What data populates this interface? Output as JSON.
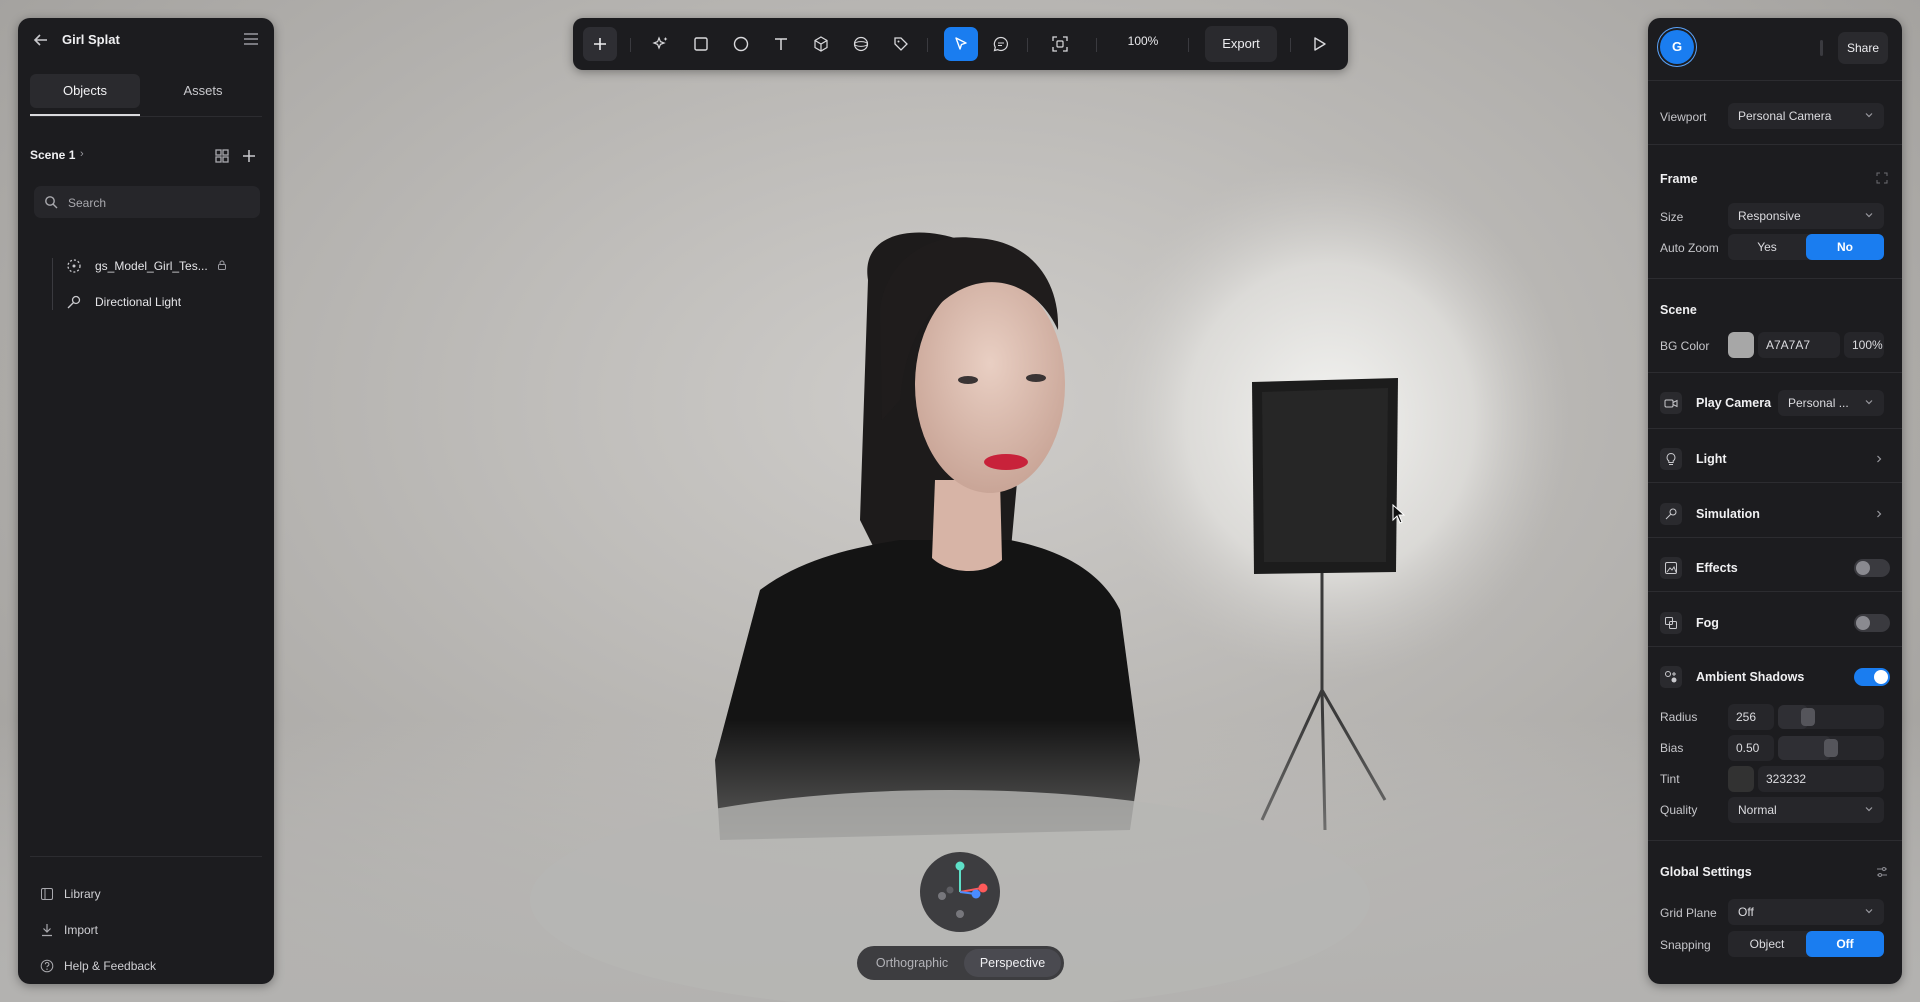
{
  "left_panel": {
    "title": "Girl Splat",
    "tabs": [
      {
        "label": "Objects",
        "active": true
      },
      {
        "label": "Assets",
        "active": false
      }
    ],
    "scene": {
      "label": "Scene 1"
    },
    "search": {
      "placeholder": "Search"
    },
    "tree": [
      {
        "label": "gs_Model_Girl_Tes...",
        "icon": "splat-icon",
        "locked": true
      },
      {
        "label": "Directional Light",
        "icon": "directional-light-icon",
        "locked": false
      }
    ],
    "footer": [
      {
        "label": "Library",
        "icon": "library-icon"
      },
      {
        "label": "Import",
        "icon": "import-icon"
      },
      {
        "label": "Help & Feedback",
        "icon": "help-icon"
      }
    ]
  },
  "toolbar": {
    "tools": [
      "add-icon",
      "ai-sparkle-icon",
      "rectangle-icon",
      "ellipse-icon",
      "text-icon",
      "cube-icon",
      "sphere-icon",
      "tag-icon",
      "select-arrow-icon",
      "comment-icon",
      "frame-icon"
    ],
    "zoom": "100%",
    "export_label": "Export",
    "play_icon": "play-icon"
  },
  "viewport": {
    "projection": [
      {
        "label": "Orthographic",
        "active": false
      },
      {
        "label": "Perspective",
        "active": true
      }
    ]
  },
  "right_panel": {
    "avatar_letter": "G",
    "share_label": "Share",
    "viewport": {
      "label": "Viewport",
      "value": "Personal Camera"
    },
    "frame": {
      "heading": "Frame",
      "size_label": "Size",
      "size_value": "Responsive",
      "autozoom_label": "Auto Zoom",
      "autozoom_options": [
        "Yes",
        "No"
      ],
      "autozoom_selected": "No"
    },
    "scene": {
      "heading": "Scene",
      "bg_label": "BG Color",
      "bg_hex": "A7A7A7",
      "bg_opacity": "100%",
      "bg_color": "#a7a7a7",
      "play_camera_label": "Play Camera",
      "play_camera_value": "Personal ...",
      "light_label": "Light",
      "simulation_label": "Simulation",
      "effects_label": "Effects",
      "effects_on": false,
      "fog_label": "Fog",
      "fog_on": false,
      "ambient_label": "Ambient Shadows",
      "ambient_on": true,
      "radius_label": "Radius",
      "radius_value": "256",
      "bias_label": "Bias",
      "bias_value": "0.50",
      "tint_label": "Tint",
      "tint_hex": "323232",
      "tint_color": "#323232",
      "quality_label": "Quality",
      "quality_value": "Normal"
    },
    "global": {
      "heading": "Global Settings",
      "grid_label": "Grid Plane",
      "grid_value": "Off",
      "snapping_label": "Snapping",
      "snapping_options": [
        "Object",
        "Off"
      ],
      "snapping_selected": "Off"
    }
  },
  "colors": {
    "accent": "#1a7df0",
    "panel": "#1c1c1f"
  }
}
